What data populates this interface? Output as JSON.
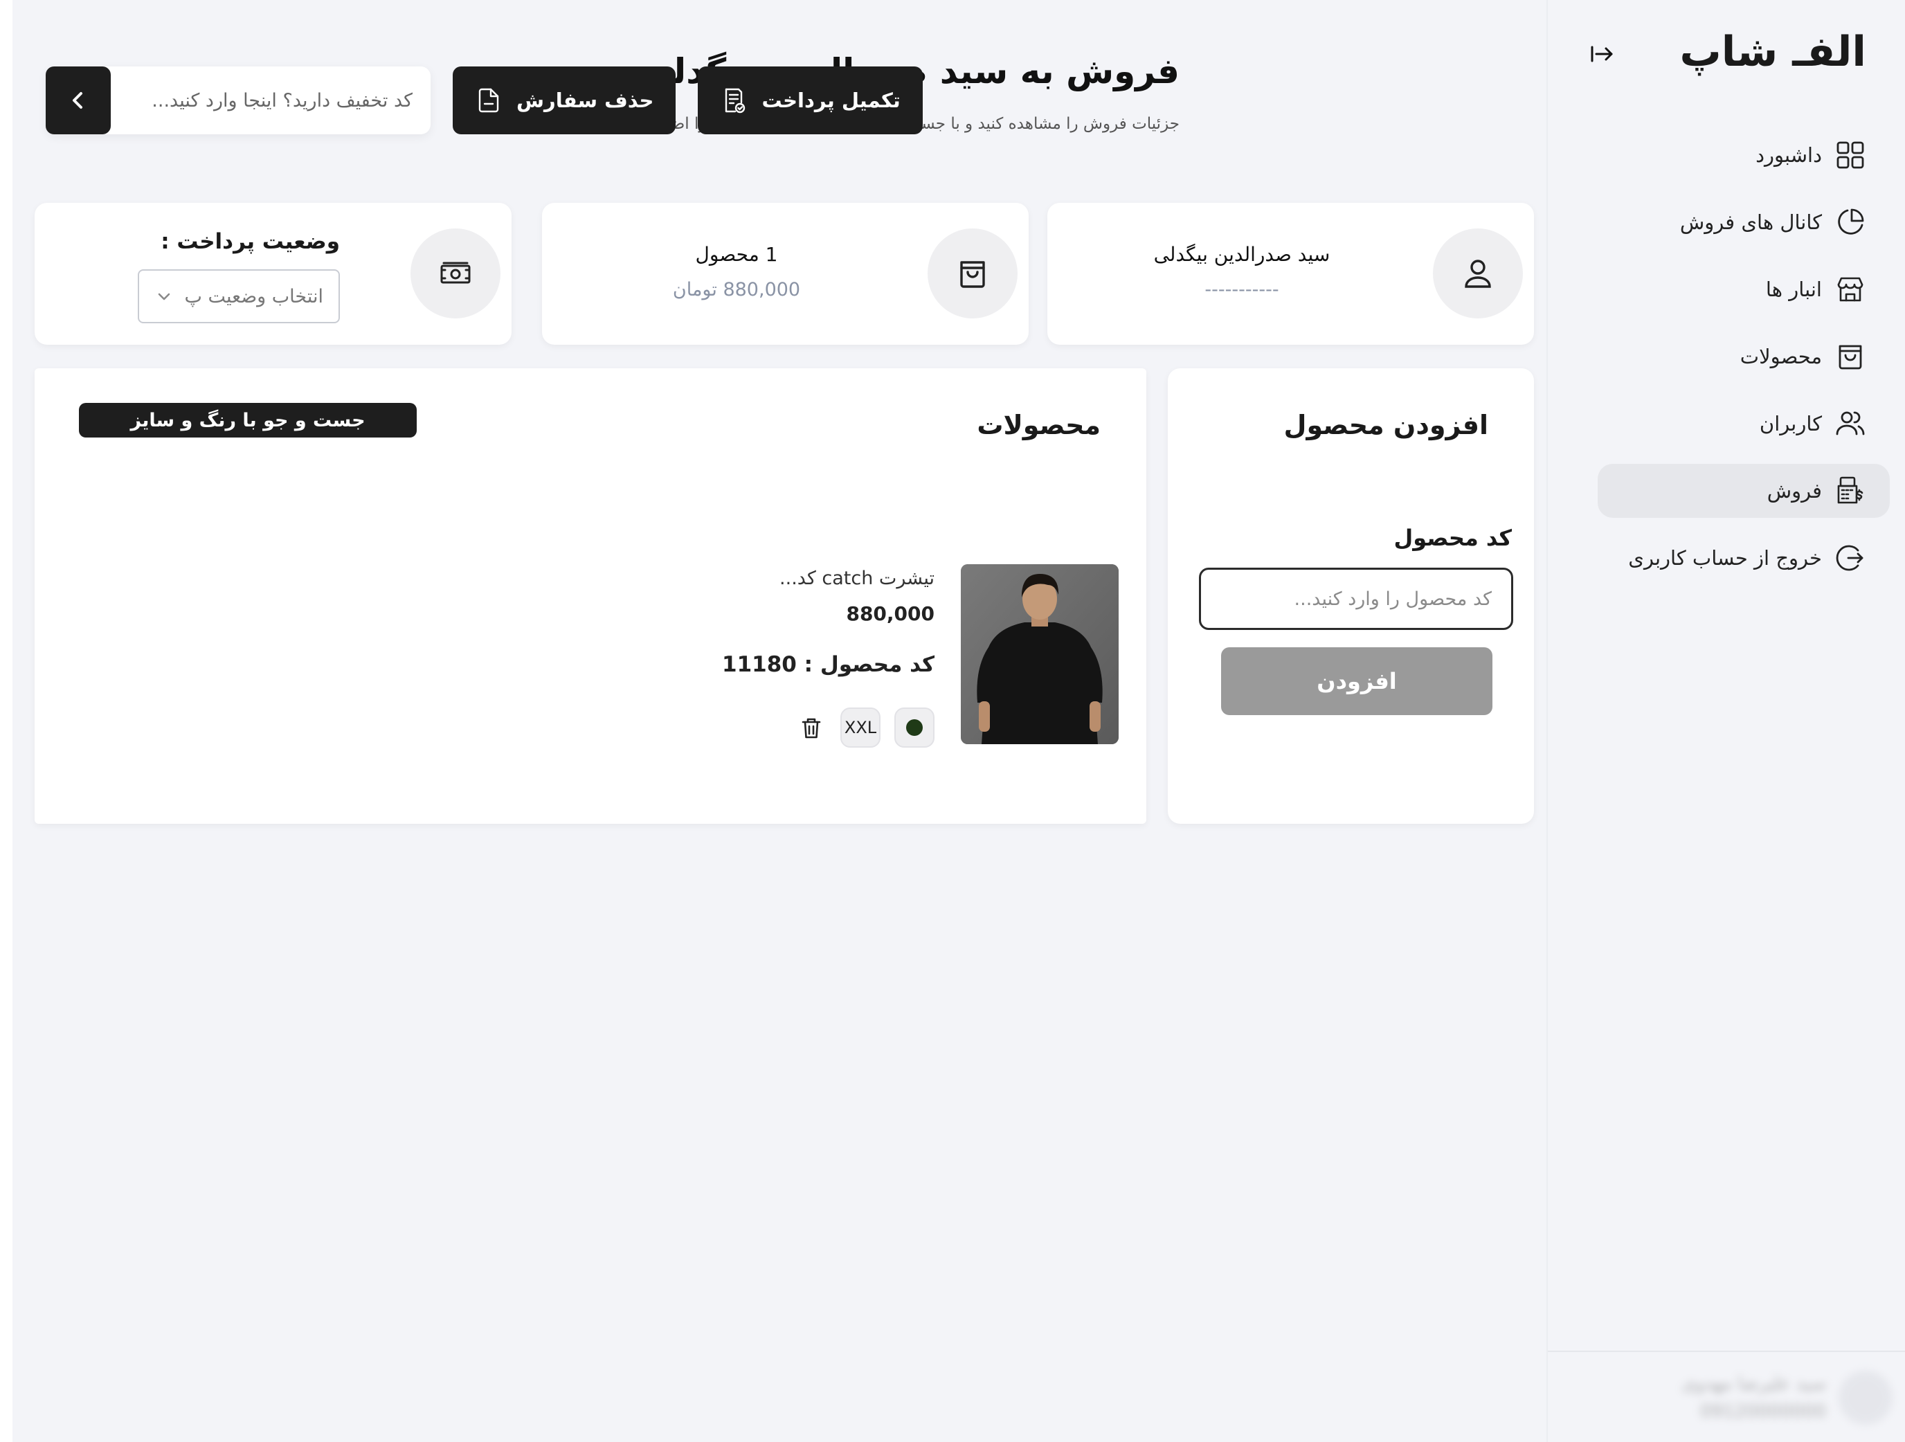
{
  "sidebar": {
    "logo": "الفـ شاپ",
    "items": [
      {
        "label": "داشبورد",
        "icon": "dashboard-grid-icon"
      },
      {
        "label": "کانال های فروش",
        "icon": "pie-chart-icon"
      },
      {
        "label": "انبار ها",
        "icon": "store-icon"
      },
      {
        "label": "محصولات",
        "icon": "shopping-bag-icon"
      },
      {
        "label": "کاربران",
        "icon": "users-icon"
      },
      {
        "label": "فروش",
        "icon": "pos-terminal-icon",
        "active": true
      },
      {
        "label": "خروج از حساب کاربری",
        "icon": "logout-icon"
      }
    ],
    "user": {
      "name": "سید علیرضا مهدوی",
      "phone": "09120000000"
    }
  },
  "header": {
    "title": "فروش به سید صدرالدین بیگدلی",
    "subtitle": "جزئیات فروش را مشاهده کنید و با جست و جوی کد محصول ، محصول را اضافه کنید.",
    "discount_placeholder": "کد تخفیف دارید؟ اینجا وارد کنید...",
    "delete_order_label": "حذف سفارش",
    "complete_payment_label": "تکمیل پرداخت"
  },
  "customer_card": {
    "name": "سید صدرالدین بیگدلی",
    "phone": "-----------"
  },
  "order_card": {
    "count": "1 محصول",
    "total": "880,000 تومان"
  },
  "payment_card": {
    "title": "وضعیت پرداخت :",
    "select_value": "انتخاب وضعیت پ"
  },
  "add_product": {
    "title": "افزودن محصول",
    "field_label": "کد محصول",
    "placeholder": "کد محصول را وارد کنید...",
    "button_label": "افزودن"
  },
  "products": {
    "title": "محصولات",
    "search_label": "جست و جو با رنگ و سایز",
    "items": [
      {
        "name": "تیشرت catch کد...",
        "price": "880,000",
        "code": "کد محصول : 11180",
        "size": "XXL",
        "color": "#1f3a17"
      }
    ]
  },
  "colors": {
    "accent": "#1e1e1e",
    "background": "#f3f4f8",
    "muted": "#8a93a5",
    "disabled_button": "#9a9a9a"
  }
}
